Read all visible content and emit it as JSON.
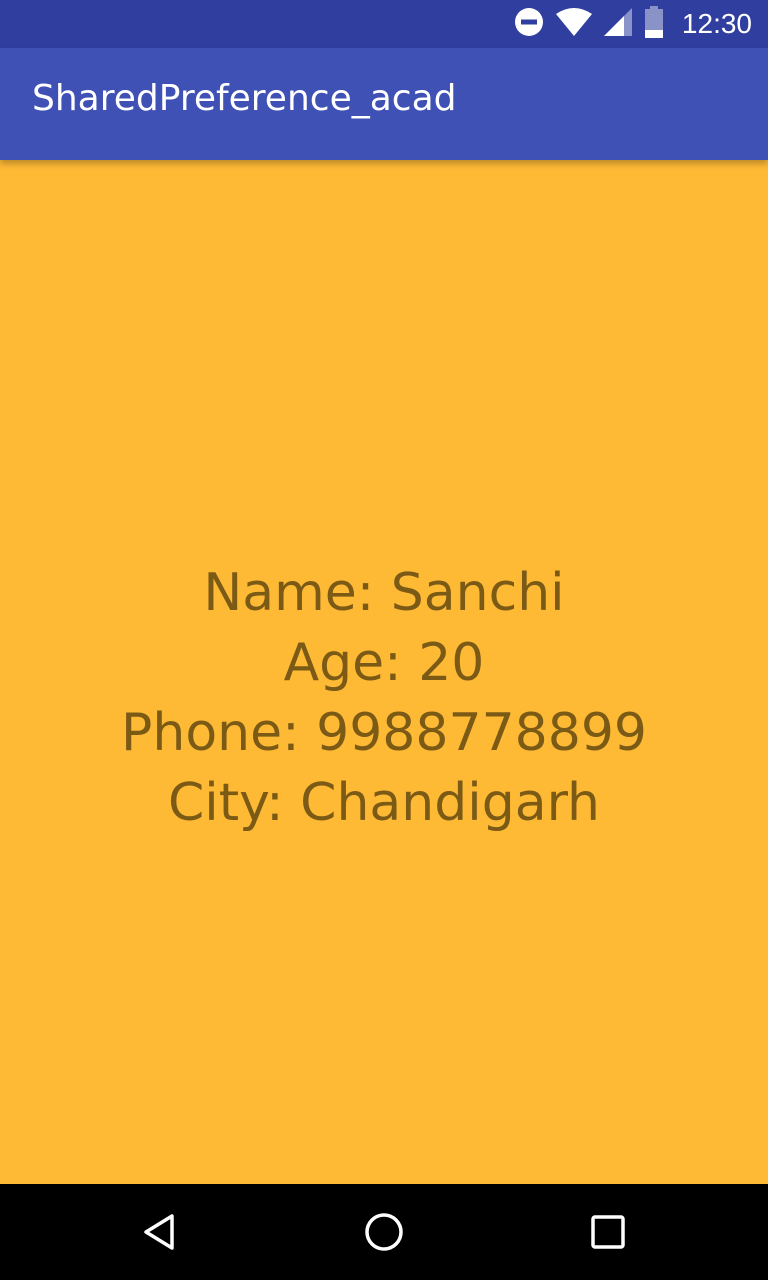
{
  "status_bar": {
    "time": "12:30",
    "icons": [
      "do-not-disturb-icon",
      "wifi-icon",
      "signal-icon",
      "battery-icon"
    ]
  },
  "app_bar": {
    "title": "SharedPreference_acad",
    "color": "#3F51B5"
  },
  "content": {
    "background_color": "#FFBA35",
    "text_color": "#7B5A16",
    "lines": [
      "Name: Sanchi",
      "Age: 20",
      "Phone: 9988778899",
      "City: Chandigarh"
    ]
  },
  "nav_bar": {
    "buttons": [
      "back-icon",
      "home-icon",
      "recents-icon"
    ]
  }
}
